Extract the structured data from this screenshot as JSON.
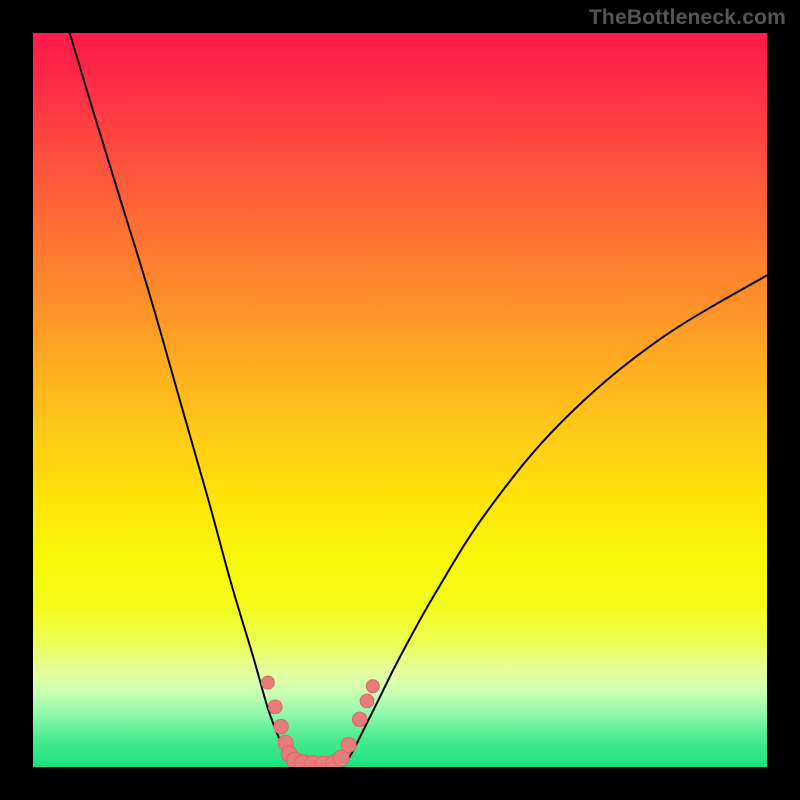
{
  "watermark": "TheBottleneck.com",
  "chart_data": {
    "type": "line",
    "title": "",
    "xlabel": "",
    "ylabel": "",
    "xlim": [
      0,
      100
    ],
    "ylim": [
      0,
      100
    ],
    "note": "Decorative bottleneck V-curve on a red→green vertical gradient; bottom green band indicates optimal region.",
    "left_branch": {
      "name": "left-curve",
      "x": [
        5,
        8,
        12,
        16,
        20,
        24,
        27,
        30,
        32,
        33.5,
        34.5,
        35,
        35.3
      ],
      "y": [
        100,
        90,
        77,
        64,
        50,
        36,
        25,
        15,
        8,
        4,
        2,
        1,
        0.5
      ]
    },
    "right_branch": {
      "name": "right-curve",
      "x": [
        42.5,
        43.5,
        45,
        47,
        50,
        55,
        62,
        72,
        85,
        100
      ],
      "y": [
        0.5,
        2,
        5,
        9,
        15,
        24,
        35,
        47,
        58,
        67
      ]
    },
    "floor_segment": {
      "name": "valley-floor",
      "x": [
        35.3,
        36.5,
        38,
        39.5,
        41,
        42.5
      ],
      "y": [
        0.5,
        0.2,
        0.1,
        0.1,
        0.2,
        0.5
      ]
    },
    "markers": [
      {
        "x": 32.0,
        "y": 11.5
      },
      {
        "x": 33.0,
        "y": 8.2
      },
      {
        "x": 33.8,
        "y": 5.5
      },
      {
        "x": 34.4,
        "y": 3.3
      },
      {
        "x": 34.9,
        "y": 1.8
      },
      {
        "x": 35.7,
        "y": 0.9
      },
      {
        "x": 36.8,
        "y": 0.5
      },
      {
        "x": 38.2,
        "y": 0.3
      },
      {
        "x": 39.6,
        "y": 0.3
      },
      {
        "x": 41.0,
        "y": 0.5
      },
      {
        "x": 42.0,
        "y": 1.2
      },
      {
        "x": 43.0,
        "y": 3.0
      },
      {
        "x": 44.5,
        "y": 6.5
      },
      {
        "x": 45.5,
        "y": 9.0
      },
      {
        "x": 46.3,
        "y": 11.0
      }
    ],
    "colors": {
      "curve": "#000000",
      "marker_fill": "#e77c7a",
      "marker_stroke": "#da6866",
      "gradient_top": "#ff1a4b",
      "gradient_bottom": "#19e17e"
    }
  }
}
